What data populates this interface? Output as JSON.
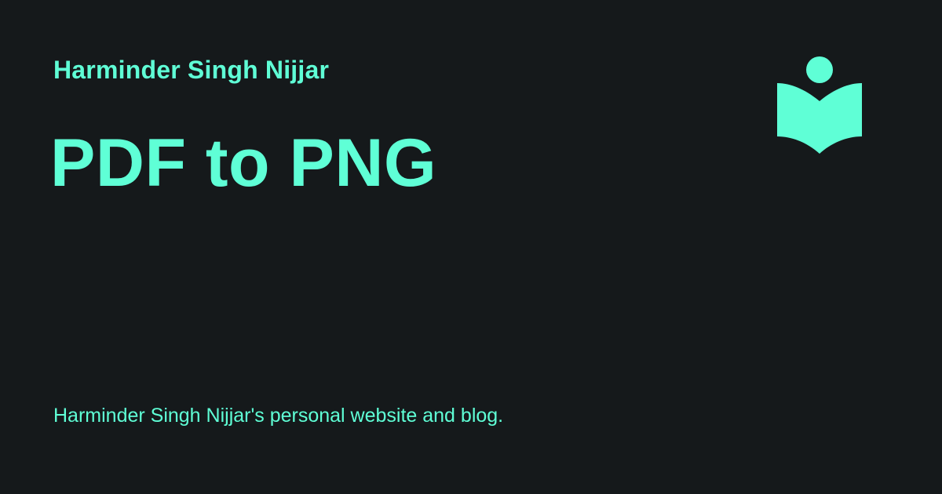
{
  "card": {
    "author": "Harminder Singh Nijjar",
    "title": "PDF to PNG",
    "description": "Harminder Singh Nijjar's personal website and blog.",
    "logo_icon": "reader-book-icon"
  },
  "colors": {
    "background": "#15191b",
    "accent": "#5fffd6"
  }
}
